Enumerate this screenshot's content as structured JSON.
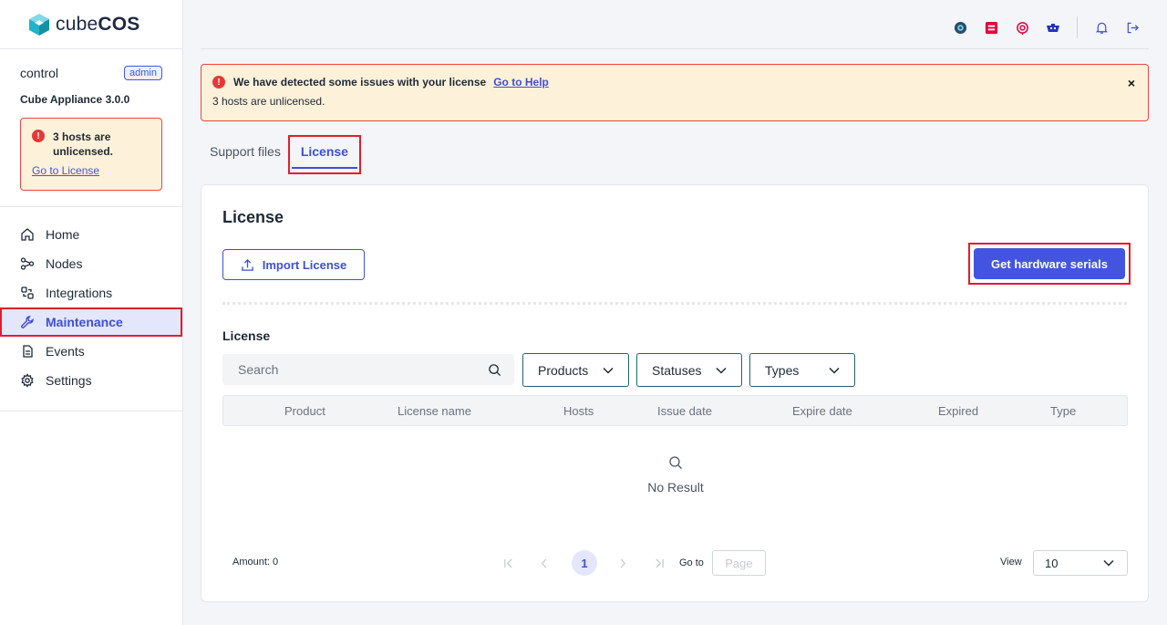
{
  "app": {
    "logo_text_light": "cube",
    "logo_text_bold": "COS"
  },
  "user": {
    "name": "control",
    "role": "admin",
    "version": "Cube Appliance 3.0.0"
  },
  "sidebar_alert": {
    "message": "3 hosts are unlicensed.",
    "link": "Go to License"
  },
  "nav": {
    "items": [
      {
        "label": "Home",
        "icon": "home-icon"
      },
      {
        "label": "Nodes",
        "icon": "nodes-icon"
      },
      {
        "label": "Integrations",
        "icon": "integrations-icon"
      },
      {
        "label": "Maintenance",
        "icon": "wrench-icon",
        "active": true
      },
      {
        "label": "Events",
        "icon": "events-icon"
      },
      {
        "label": "Settings",
        "icon": "gear-icon"
      }
    ]
  },
  "header": {
    "icons": [
      "ceph-icon",
      "openstack-icon",
      "grafana-icon",
      "kubernetes-icon",
      "bell-icon",
      "logout-icon"
    ]
  },
  "banner": {
    "title": "We have detected some issues with your license",
    "link": "Go to Help",
    "subtitle": "3 hosts are unlicensed.",
    "close": "×"
  },
  "tabs": [
    {
      "label": "Support files"
    },
    {
      "label": "License",
      "active": true
    }
  ],
  "card": {
    "title": "License",
    "import_button": "Import License",
    "hardware_button": "Get hardware serials",
    "section_title": "License",
    "search_placeholder": "Search",
    "filters": {
      "products": "Products",
      "statuses": "Statuses",
      "types": "Types"
    },
    "columns": [
      "Product",
      "License name",
      "Hosts",
      "Issue date",
      "Expire date",
      "Expired",
      "Type"
    ],
    "empty_text": "No Result"
  },
  "footer": {
    "amount": "Amount: 0",
    "current_page": "1",
    "goto_label": "Go to",
    "page_placeholder": "Page",
    "view_label": "View",
    "view_value": "10"
  },
  "colors": {
    "accent": "#4355e0",
    "alert_bg": "#fdf1d9",
    "alert_border": "#ef4444",
    "highlight": "#e11d2e"
  }
}
